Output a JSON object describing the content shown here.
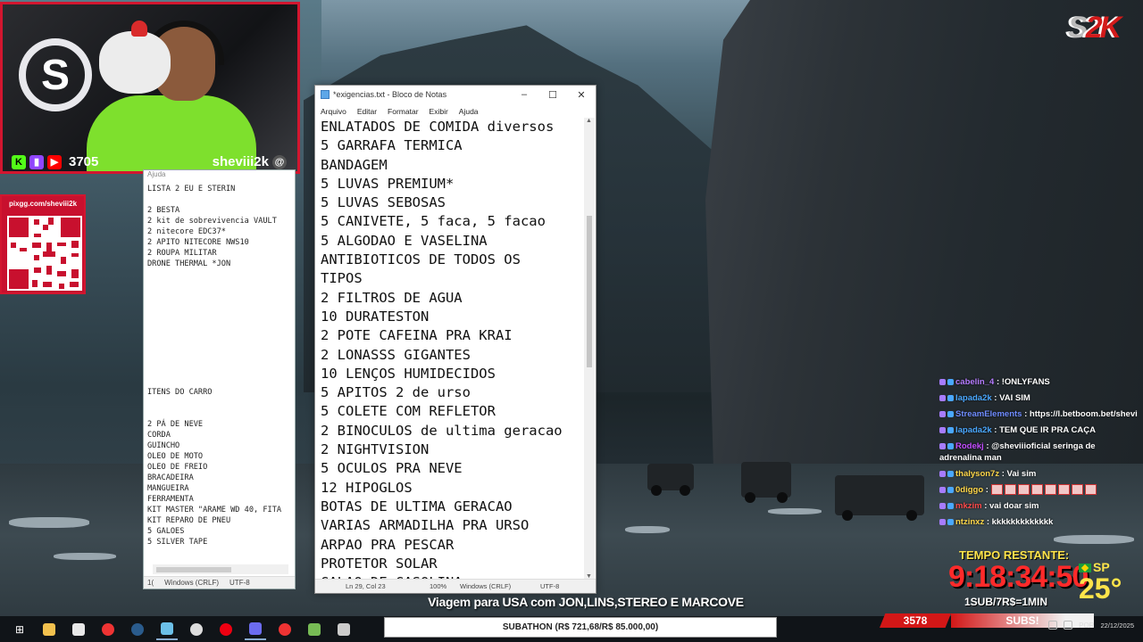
{
  "webcam": {
    "logo_letter": "S",
    "viewer_count": "3705",
    "channel_name": "sheviii2k",
    "social_icons": [
      "kick-icon",
      "twitch-icon",
      "youtube-icon"
    ]
  },
  "qr_panel": {
    "title": "pixgg.com/sheviii2k"
  },
  "small_notepad": {
    "menu_ghost": "Ajuda",
    "lines": [
      "LISTA 2 EU E STERIN",
      "",
      "2 BESTA",
      "2 kit de sobrevivencia VAULT",
      "2 nitecore EDC37*",
      "2 APITO NITECORE NWS10",
      "2 ROUPA MILITAR",
      "DRONE THERMAL *JON",
      "",
      "",
      "",
      "",
      "",
      "",
      "",
      "",
      "",
      "",
      "",
      "ITENS DO CARRO",
      "",
      "",
      "2 PÁ DE NEVE",
      "CORDA",
      "GUINCHO",
      "OLEO DE MOTO",
      "OLEO DE FREIO",
      "BRACADEIRA",
      "MANGUEIRA",
      "FERRAMENTA",
      "KIT MASTER \"ARAME WD 40, FITA",
      "KIT REPARO DE PNEU",
      "5 GALOES",
      "5 SILVER TAPE"
    ],
    "status_encoding": "Windows (CRLF)",
    "status_charset": "UTF-8"
  },
  "notepad": {
    "title": "*exigencias.txt - Bloco de Notas",
    "menu": [
      "Arquivo",
      "Editar",
      "Formatar",
      "Exibir",
      "Ajuda"
    ],
    "lines": [
      "ENLATADOS DE COMIDA diversos",
      "5 GARRAFA TERMICA",
      "BANDAGEM",
      "5 LUVAS PREMIUM*",
      "5 LUVAS SEBOSAS",
      "5 CANIVETE, 5 faca, 5 facao",
      "5 ALGODAO E VASELINA",
      "ANTIBIOTICOS DE TODOS OS",
      "TIPOS",
      "2 FILTROS DE AGUA",
      "10 DURATESTON",
      "2 POTE CAFEINA PRA KRAI",
      "2 LONASSS GIGANTES",
      "10 LENÇOS HUMIDECIDOS",
      "5 APITOS 2 de urso",
      "5 COLETE COM REFLETOR",
      "2 BINOCULOS de ultima geracao",
      "2 NIGHTVISION",
      "5 OCULOS PRA NEVE",
      "12 HIPOGLOS",
      "BOTAS DE ULTIMA GERACAO",
      "VARIAS ARMADILHA PRA URSO",
      "ARPAO PRA PESCAR",
      "PROTETOR SOLAR",
      "GALAO DE GASOLINA"
    ],
    "status": {
      "position": "Ln 29, Col 23",
      "zoom": "100%",
      "line_ending": "Windows (CRLF)",
      "encoding": "UTF-8"
    }
  },
  "chat": [
    {
      "user": "cabelin_4",
      "color": "#b57cff",
      "text": "!ONLYFANS"
    },
    {
      "user": "lapada2k",
      "color": "#4aa8ff",
      "text": "VAI SIM"
    },
    {
      "user": "StreamElements",
      "color": "#6f8cff",
      "text": "https://l.betboom.bet/shevi"
    },
    {
      "user": "lapada2k",
      "color": "#4aa8ff",
      "text": "TEM QUE IR PRA CAÇA"
    },
    {
      "user": "Rodekj",
      "color": "#c34cff",
      "text": "@sheviiioficial seringa de adrenalina man"
    },
    {
      "user": "thalyson7z",
      "color": "#ffd74a",
      "text": "Vai sim"
    },
    {
      "user": "0diggo",
      "color": "#ffd74a",
      "text": ""
    },
    {
      "user": "mkzim",
      "color": "#ff4a4a",
      "text": "vai doar sim"
    },
    {
      "user": "ntzinxz",
      "color": "#ffd74a",
      "text": "kkkkkkkkkkkkk"
    }
  ],
  "timer": {
    "label": "TEMPO RESTANTE:",
    "value": "9:18:34:50",
    "rule": "1SUB/7R$=1MIN"
  },
  "weather": {
    "city": "SP",
    "temperature": "25°"
  },
  "banner": "Viagem para USA com JON,LINS,STEREO E MARCOVE",
  "subathon": "SUBATHON (R$ 721,68/R$ 85.000,00)",
  "counter": "3578",
  "subs_label": "SUBS!",
  "tray": {
    "lang": "POR",
    "date": "22/12/2025"
  },
  "taskbar_icons": [
    "windows-start-icon",
    "search-icon",
    "folder-icon",
    "store-icon",
    "chrome-icon",
    "steam-icon",
    "notepad-icon",
    "obs-icon",
    "opera-icon",
    "discord-icon",
    "chrome-icon",
    "app-icon",
    "calculator-icon"
  ],
  "colors": {
    "accent_red": "#d2162f",
    "timer_red": "#ff2a2a",
    "timer_yellow": "#ffe44a"
  }
}
